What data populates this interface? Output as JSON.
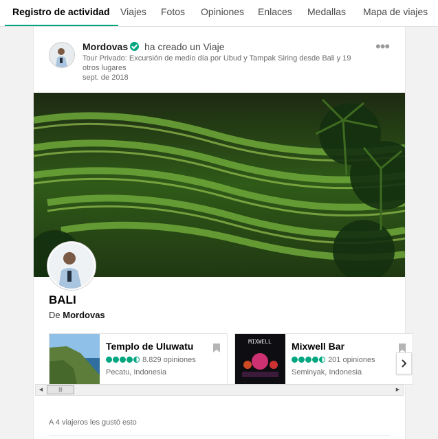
{
  "tabs": [
    {
      "label": "Registro de actividad",
      "active": true
    },
    {
      "label": "Viajes"
    },
    {
      "label": "Fotos"
    },
    {
      "label": "Opiniones"
    },
    {
      "label": "Enlaces"
    },
    {
      "label": "Medallas"
    },
    {
      "label": "Mapa de viajes"
    }
  ],
  "post": {
    "author": "Mordovas",
    "action": "ha creado un Viaje",
    "trip_title": "Tour Privado: Excursión de medio día por Ubud y Tampak Siring desde Bali y 19 otros lugares",
    "date": "sept. de 2018",
    "menu_icon": "ellipsis-icon"
  },
  "trip": {
    "place": "BALI",
    "by_prefix": "De",
    "by_author": "Mordovas"
  },
  "pois": [
    {
      "name": "Templo de Uluwatu",
      "reviews": "8.829 opiniones",
      "location": "Pecatu, Indonesia",
      "rating_of_5": 4.5
    },
    {
      "name": "Mixwell Bar",
      "reviews": "201 opiniones",
      "location": "Seminyak, Indonesia",
      "rating_of_5": 4.5,
      "sign_text": "MIXWELL"
    }
  ],
  "likes": "A 4 viajeros les gustó esto",
  "colors": {
    "accent": "#00a680"
  }
}
